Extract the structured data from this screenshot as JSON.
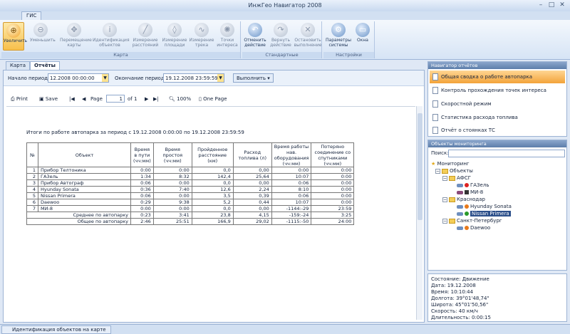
{
  "window": {
    "title": "ИнжГео Навигатор 2008"
  },
  "ribbon": {
    "tab": "ГИС",
    "buttons": [
      {
        "label": "Увеличить",
        "icon": "zoom-in-icon"
      },
      {
        "label": "Уменьшить",
        "icon": "zoom-out-icon"
      },
      {
        "label": "Перемещение карты",
        "icon": "pan-icon"
      },
      {
        "label": "Идентификация объектов",
        "icon": "info-icon"
      },
      {
        "label": "Измерение расстояний",
        "icon": "ruler-icon"
      },
      {
        "label": "Измерение площади",
        "icon": "area-icon"
      },
      {
        "label": "Измерение трека",
        "icon": "track-icon"
      },
      {
        "label": "Точки интереса",
        "icon": "poi-icon"
      },
      {
        "label": "Отменить действие",
        "icon": "undo-icon"
      },
      {
        "label": "Вернуть действие",
        "icon": "redo-icon"
      },
      {
        "label": "Остановить выполнение",
        "icon": "stop-icon"
      },
      {
        "label": "Параметры системы",
        "icon": "gear-icon"
      },
      {
        "label": "Окна",
        "icon": "window-icon"
      }
    ],
    "groups": [
      "Карта",
      "Стандартные",
      "Настройки"
    ]
  },
  "tabs": [
    "Карта",
    "Отчёты"
  ],
  "period": {
    "start_label": "Начало периода",
    "start_value": "12.2008 00:00:00",
    "end_label": "Окончание периода",
    "end_value": "19.12.2008 23:59:59",
    "execute": "Выполнить"
  },
  "report_toolbar": {
    "print": "Print",
    "save": "Save",
    "page_label": "Page",
    "page_value": "1",
    "of": "of 1",
    "zoom": "100%",
    "one_page": "One Page"
  },
  "report": {
    "title": "Итоги по работе автопарка за период с 19.12.2008 0:00:00 по 19.12.2008 23:59:59",
    "headers": [
      "№",
      "Объект",
      "Время в пути (чч:мм)",
      "Время простоя (чч:мм)",
      "Пройденное расстояние (км)",
      "Расход топлива (л)",
      "Время работы нав. оборудования (чч:мм)",
      "Потеряно соединение со спутниками (чч:мм)"
    ],
    "rows": [
      [
        "1",
        "Прибор Телтоника",
        "0:00",
        "0:00",
        "0,0",
        "0,00",
        "0:00",
        "0:00"
      ],
      [
        "2",
        "ГАЗель",
        "1:34",
        "8:32",
        "142,4",
        "25,64",
        "10:07",
        "0:00"
      ],
      [
        "3",
        "Прибор Автограф",
        "0:06",
        "0:00",
        "0,0",
        "0,00",
        "0:06",
        "0:00"
      ],
      [
        "4",
        "Hyunday Sonata",
        "0:36",
        "7:40",
        "12,6",
        "2,24",
        "8:10",
        "0:00"
      ],
      [
        "5",
        "Nissan Primera",
        "0:06",
        "0:00",
        "3,5",
        "0,39",
        "0:06",
        "0:00"
      ],
      [
        "6",
        "Daewoo",
        "0:29",
        "9:38",
        "5,2",
        "0,44",
        "10:07",
        "0:00"
      ],
      [
        "7",
        "МИ-8",
        "0:00",
        "0:00",
        "0,0",
        "0,00",
        "-1144:-29",
        "23:59"
      ]
    ],
    "avg": [
      "Среднее по автопарку",
      "0:23",
      "3:41",
      "23,8",
      "4,15",
      "-159:-24",
      "3:25"
    ],
    "total": [
      "Общее по автопарку",
      "2:46",
      "25:51",
      "166,9",
      "29,02",
      "-1115:-50",
      "24:00"
    ]
  },
  "reports_nav": {
    "title": "Навигатор отчётов",
    "items": [
      "Общая сводка о работе автопарка",
      "Контроль прохождения точек интереса",
      "Скоростной режим",
      "Статистика расхода топлива",
      "Отчёт о стоянках ТС"
    ]
  },
  "objects": {
    "title": "Объекты мониторинга",
    "search_label": "Поиск:",
    "tree": {
      "root": "Мониторинг",
      "objects": "Объекты",
      "afsg": "АФСГ",
      "gazel": "ГАЗель",
      "mi8": "МИ-8",
      "krasnodar": "Краснодар",
      "hyundai": "Hyunday Sonata",
      "nissan": "Nissan Primera",
      "spb": "Санкт-Петербург",
      "daewoo": "Daewoo"
    }
  },
  "info": {
    "state": "Состояние: Движение",
    "date": "Дата: 19.12.2008",
    "time": "Время: 10:10:44",
    "lon": "Долгота: 39°01'48,74\"",
    "lat": "Широта: 45°01'50,56\"",
    "speed": "Скорость: 40 км/ч",
    "duration": "Длительность: 0:00:15"
  },
  "statusbar": {
    "tab": "Идентификация объектов на карте"
  }
}
